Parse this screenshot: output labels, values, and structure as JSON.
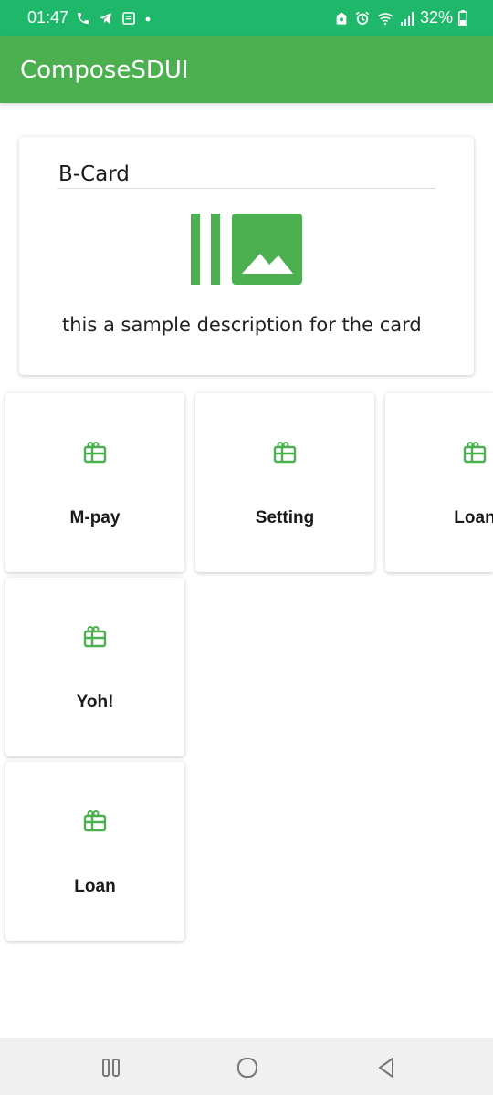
{
  "status_bar": {
    "time": "01:47",
    "battery": "32%",
    "icons": [
      "phone-icon",
      "telegram-icon",
      "message-icon",
      "dot-icon",
      "vpn-icon",
      "alarm-icon",
      "wifi-icon",
      "signal-icon",
      "battery-icon"
    ],
    "color": "#1fb86a"
  },
  "app_bar": {
    "title": "ComposeSDUI",
    "color": "#4caf50"
  },
  "bcard": {
    "title": "B-Card",
    "description": "this a sample description for the card",
    "image_icon": "image-placeholder-icon"
  },
  "tiles": [
    {
      "label": "M-pay",
      "icon": "card-giftcard-icon"
    },
    {
      "label": "Setting",
      "icon": "card-giftcard-icon"
    },
    {
      "label": "Loan",
      "icon": "card-giftcard-icon"
    },
    {
      "label": "Yoh!",
      "icon": "card-giftcard-icon"
    },
    {
      "label": "Loan",
      "icon": "card-giftcard-icon"
    }
  ],
  "nav_bar": {
    "buttons": [
      "recent-apps-icon",
      "home-icon",
      "back-icon"
    ]
  },
  "colors": {
    "accent": "#4caf50",
    "status": "#1fb86a"
  }
}
